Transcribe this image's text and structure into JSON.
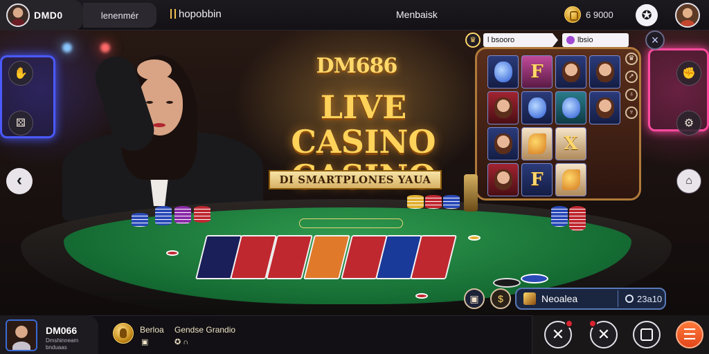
{
  "topbar": {
    "username": "DMD0",
    "pill_label": "lenenmér",
    "brand": "hopobbin",
    "center_title": "Menbaisk",
    "balance": "6 9000",
    "gift_icon": "star-badge-icon",
    "coin_icon": "coin-icon"
  },
  "hero": {
    "logo": "DM686",
    "title_line1": "LIVE CASINO",
    "title_line2": "CASINO",
    "banner": "DI SMARTPLONES YAUA"
  },
  "slot": {
    "field1": "l bsooro",
    "field2": "lbsio",
    "close_label": "×",
    "side_icons": [
      "♛",
      "➚",
      "♁",
      "♆"
    ],
    "cells": [
      {
        "style": "blue",
        "fig": "blue",
        "text": ""
      },
      {
        "style": "pink",
        "fig": "gold",
        "text": "F"
      },
      {
        "style": "",
        "fig": "face",
        "text": ""
      },
      {
        "style": "",
        "fig": "face",
        "text": ""
      },
      {
        "style": "red",
        "fig": "face",
        "text": ""
      },
      {
        "style": "",
        "fig": "blue",
        "text": ""
      },
      {
        "style": "teal",
        "fig": "blue",
        "text": ""
      },
      {
        "style": "",
        "fig": "face",
        "text": ""
      },
      {
        "style": "",
        "fig": "face",
        "text": ""
      },
      {
        "style": "cream",
        "fig": "fruit",
        "text": ""
      },
      {
        "style": "cream",
        "fig": "gold",
        "text": "X"
      },
      {
        "style": "empty",
        "fig": "",
        "text": ""
      },
      {
        "style": "red",
        "fig": "face",
        "text": ""
      },
      {
        "style": "",
        "fig": "gold",
        "text": "F"
      },
      {
        "style": "cream",
        "fig": "fruit",
        "text": ""
      },
      {
        "style": "empty",
        "fig": "",
        "text": ""
      }
    ]
  },
  "table": {
    "player_name": "Neoalea",
    "player_stat": "23a10"
  },
  "bottom": {
    "username": "DM066",
    "subtext": "Dmshinneam bnduaas",
    "label1": "Berloa",
    "label2": "Gendse Grandio",
    "icon_row1": "▣",
    "icon_row2": "✪ ∩"
  },
  "colors": {
    "accent_gold": "#ffd35a",
    "felt_green": "#1f8040",
    "tool_orange": "#ff6a2a"
  }
}
